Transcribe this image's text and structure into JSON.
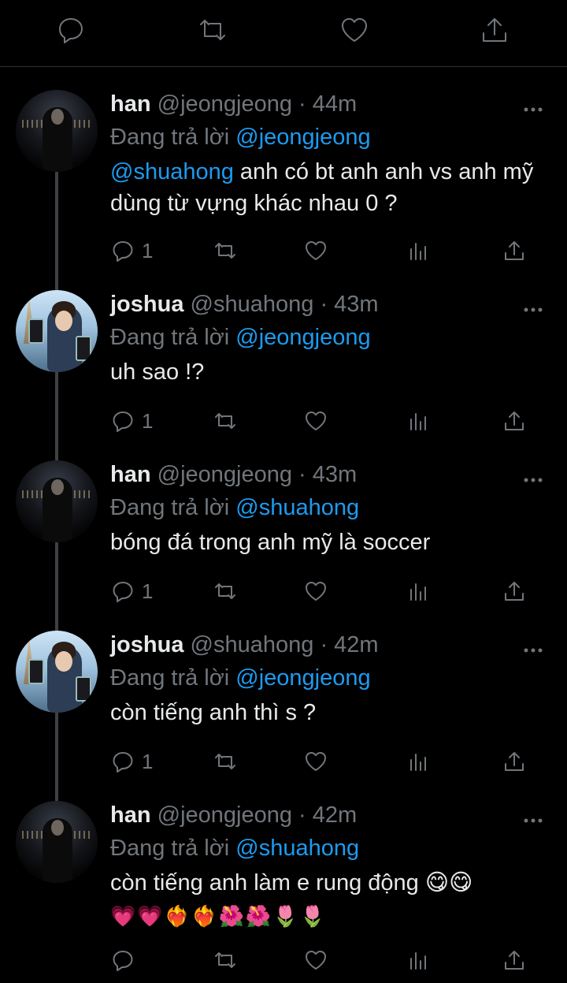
{
  "top_actions": {
    "reply": "reply-icon",
    "retweet": "retweet-icon",
    "like": "heart-icon",
    "share": "share-icon"
  },
  "replying_prefix": "Đang trả lời",
  "tweets": [
    {
      "name": "han",
      "handle": "@jeongjeong",
      "time": "44m",
      "replying_to": "@jeongjeong",
      "mention": "@shuahong",
      "text": " anh có bt anh anh vs anh mỹ dùng từ vựng khác nhau 0 ?",
      "emojis": "",
      "reply_count": "1"
    },
    {
      "name": "joshua",
      "handle": "@shuahong",
      "time": "43m",
      "replying_to": "@jeongjeong",
      "mention": "",
      "text": "uh sao !?",
      "emojis": "",
      "reply_count": "1"
    },
    {
      "name": "han",
      "handle": "@jeongjeong",
      "time": "43m",
      "replying_to": "@shuahong",
      "mention": "",
      "text": "bóng đá trong anh mỹ là soccer",
      "emojis": "",
      "reply_count": "1"
    },
    {
      "name": "joshua",
      "handle": "@shuahong",
      "time": "42m",
      "replying_to": "@jeongjeong",
      "mention": "",
      "text": "còn tiếng anh thì s ?",
      "emojis": "",
      "reply_count": "1"
    },
    {
      "name": "han",
      "handle": "@jeongjeong",
      "time": "42m",
      "replying_to": "@shuahong",
      "mention": "",
      "text": "còn tiếng anh làm e rung động 😋😋",
      "emojis": "💗💗❤️‍🔥❤️‍🔥🌺🌺🌷🌷",
      "reply_count": ""
    }
  ],
  "colors": {
    "background": "#000000",
    "text": "#e7e9ea",
    "muted": "#71767b",
    "link": "#1d9bf0",
    "thread_line": "#3e4144"
  }
}
